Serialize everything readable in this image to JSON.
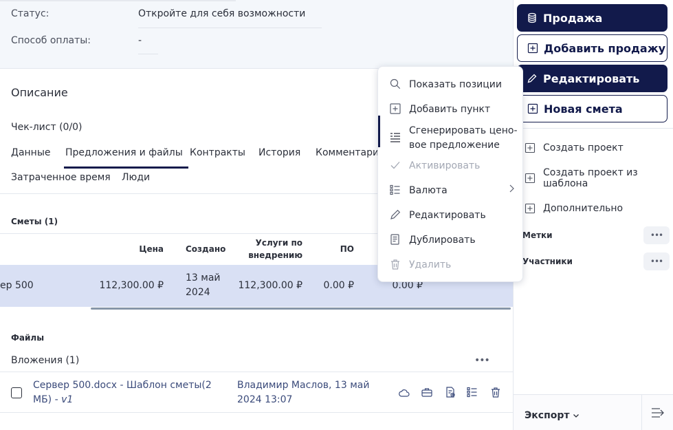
{
  "details": {
    "status_label": "Статус:",
    "status_value": "Откройте для себя возможности",
    "payment_label": "Способ оплаты:",
    "payment_value": "-"
  },
  "description_title": "Описание",
  "checklist": "Чек-лист (0/0)",
  "tabs": [
    {
      "label": "Данные",
      "active": false
    },
    {
      "label": "Предложения и файлы",
      "active": true
    },
    {
      "label": "Контракты",
      "active": false
    },
    {
      "label": "История",
      "active": false
    },
    {
      "label": "Комментарии",
      "active": false
    },
    {
      "label": "Затраченное время",
      "active": false
    },
    {
      "label": "Люди",
      "active": false
    }
  ],
  "estimates": {
    "heading": "Сметы (1)",
    "columns": [
      "Цена",
      "Создано",
      "Услуги по внедрению",
      "ПО",
      "…"
    ],
    "row": {
      "name": "ер 500",
      "price": "112,300.00 ₽",
      "created": "13 май 2024",
      "services": "112,300.00 ₽",
      "software": "0.00 ₽",
      "other": "0.00 ₽"
    }
  },
  "files": {
    "heading": "Файлы",
    "attachments_label": "Вложения (1)",
    "file_name": "Сервер 500.docx - Шаблон сметы(2 МБ) -",
    "file_version": "v1",
    "file_meta": "Владимир Маслов, 13 май 2024 13:07",
    "more_label": "•••"
  },
  "context_menu": [
    {
      "label": "Показать позиции",
      "icon": "search-icon",
      "disabled": false
    },
    {
      "label": "Добавить пункт",
      "icon": "plus-square-icon",
      "disabled": false
    },
    {
      "label": "Сгенерировать цено-вое предложение",
      "icon": "list-generate-icon",
      "disabled": false
    },
    {
      "label": "Активировать",
      "icon": "check-icon",
      "disabled": true
    },
    {
      "label": "Валюта",
      "icon": "list-icon",
      "disabled": false,
      "submenu": true
    },
    {
      "label": "Редактировать",
      "icon": "pencil-icon",
      "disabled": false
    },
    {
      "label": "Дублировать",
      "icon": "duplicate-icon",
      "disabled": false
    },
    {
      "label": "Удалить",
      "icon": "trash-icon",
      "disabled": true
    }
  ],
  "sidebar": {
    "sale_button": "Продажа",
    "add_sale_button": "Добавить продажу",
    "edit_button": "Редактировать",
    "new_estimate_button": "Новая смета",
    "links": [
      {
        "label": "Создать проект"
      },
      {
        "label": "Создать проект из шаблона"
      },
      {
        "label": "Дополнительно"
      }
    ],
    "tags_heading": "Метки",
    "participants_heading": "Участники",
    "more_label": "•••",
    "export_label": "Экспорт"
  },
  "colors": {
    "accent_dark": "#121a4b",
    "selected_row": "#d9e0f4",
    "panel_bg": "#f4f7fb"
  }
}
